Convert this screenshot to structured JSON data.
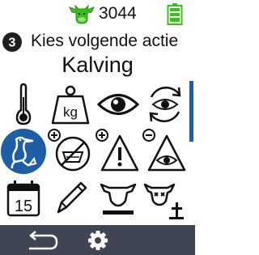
{
  "status": {
    "animal_icon": "cow-head-icon",
    "animal_number": "3044",
    "battery_icon": "battery-full-icon",
    "battery_color": "#3bbf1a",
    "cow_icon_color": "#3bbf1a"
  },
  "header": {
    "step": "3",
    "prompt": "Kies volgende actie",
    "title": "Kalving"
  },
  "actions": [
    {
      "icon": "thermometer-icon"
    },
    {
      "icon": "weight-kg-icon",
      "label": "kg"
    },
    {
      "icon": "eye-icon"
    },
    {
      "icon": "eye-refresh-icon"
    },
    {
      "icon": "calving-stork-icon",
      "selected": true
    },
    {
      "icon": "add-no-milk-icon"
    },
    {
      "icon": "add-warning-icon"
    },
    {
      "icon": "remove-attention-eye-icon"
    },
    {
      "icon": "calendar-icon",
      "label": "15"
    },
    {
      "icon": "pencil-icon"
    },
    {
      "icon": "cow-remove-icon"
    },
    {
      "icon": "cow-dead-icon"
    }
  ],
  "colors": {
    "accent": "#1e5ea6",
    "footer": "#3f4553"
  },
  "footer": {
    "back_icon": "back-arrow-icon",
    "settings_icon": "gear-icon"
  }
}
